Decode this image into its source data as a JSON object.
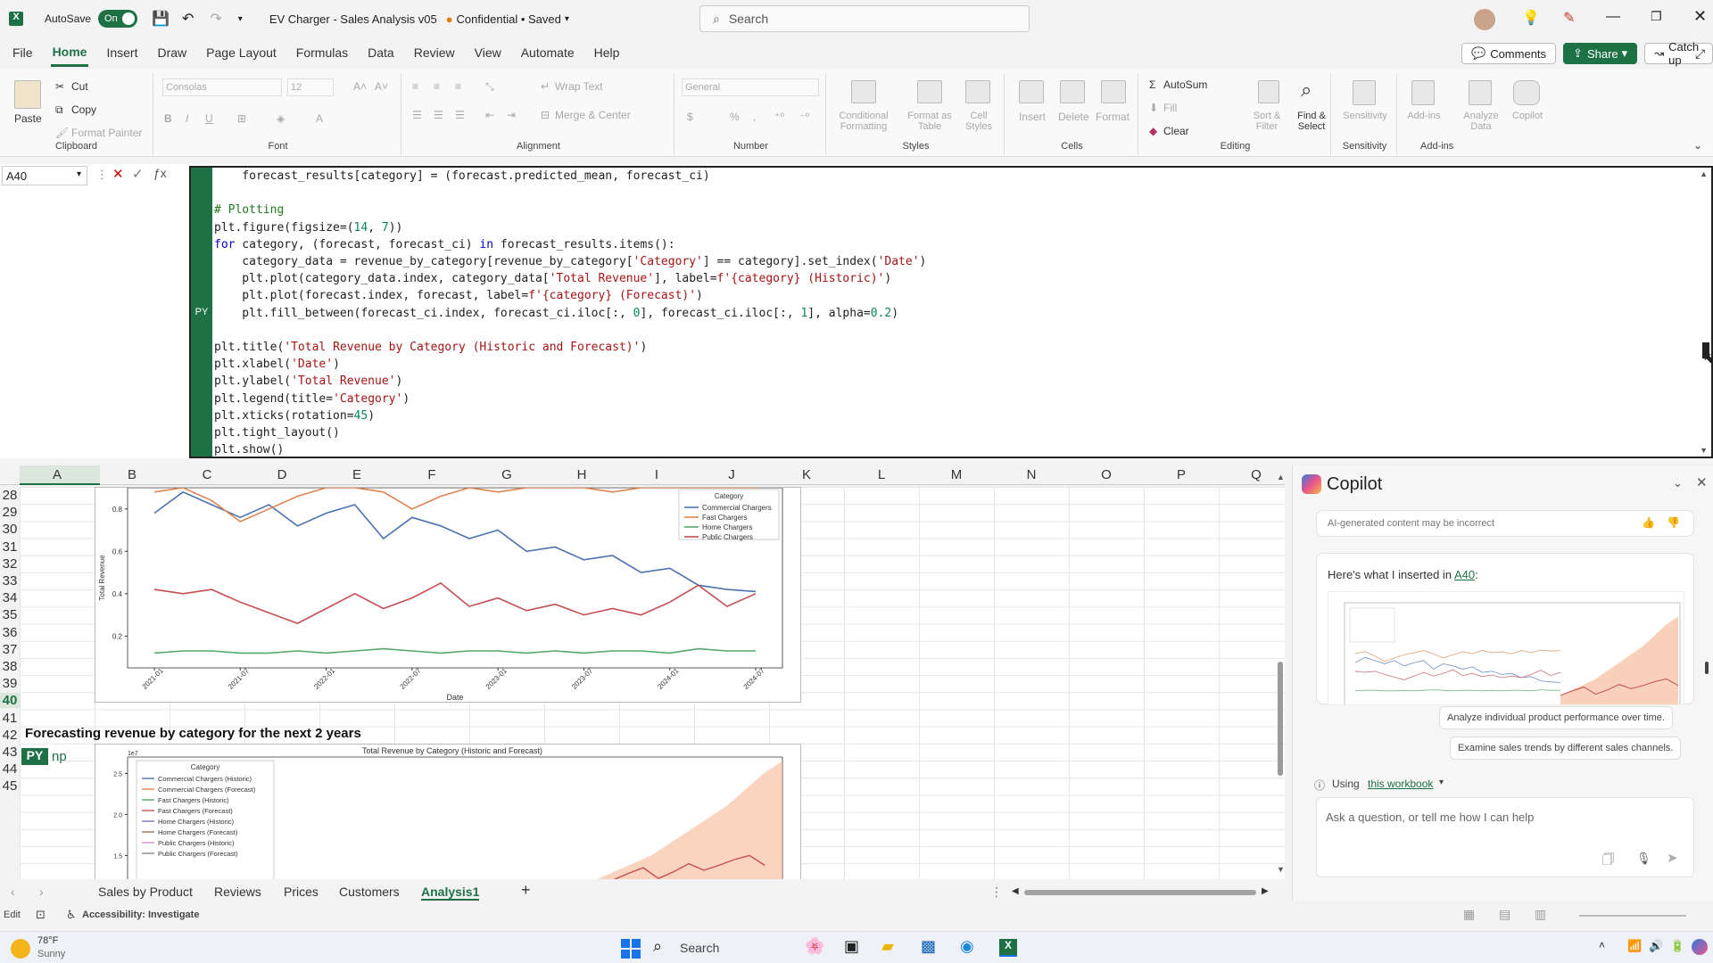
{
  "titlebar": {
    "autosave_label": "AutoSave",
    "autosave_state": "On",
    "filename": "EV Charger - Sales Analysis v05",
    "sensitivity": "Confidential • Saved",
    "search_placeholder": "Search"
  },
  "menu": {
    "items": [
      "File",
      "Home",
      "Insert",
      "Draw",
      "Page Layout",
      "Formulas",
      "Data",
      "Review",
      "View",
      "Automate",
      "Help"
    ],
    "active": "Home",
    "comments": "Comments",
    "share": "Share",
    "catchup": "Catch up"
  },
  "ribbon": {
    "clipboard": {
      "paste": "Paste",
      "cut": "Cut",
      "copy": "Copy",
      "format_painter": "Format Painter",
      "label": "Clipboard"
    },
    "font": {
      "name": "Consolas",
      "size": "12",
      "label": "Font"
    },
    "alignment": {
      "wrap": "Wrap Text",
      "merge": "Merge & Center",
      "label": "Alignment"
    },
    "number": {
      "format": "General",
      "label": "Number"
    },
    "styles": {
      "conditional": "Conditional Formatting",
      "table": "Format as Table",
      "cell": "Cell Styles",
      "label": "Styles"
    },
    "cells": {
      "insert": "Insert",
      "delete": "Delete",
      "format": "Format",
      "label": "Cells"
    },
    "editing": {
      "autosum": "AutoSum",
      "fill": "Fill",
      "clear": "Clear",
      "sort": "Sort & Filter",
      "find": "Find & Select",
      "label": "Editing"
    },
    "sensitivity": {
      "btn": "Sensitivity",
      "label": "Sensitivity"
    },
    "addins": {
      "btn": "Add-ins",
      "analyze": "Analyze Data",
      "copilot": "Copilot",
      "label": "Add-ins"
    }
  },
  "formula": {
    "cell_ref": "A40",
    "py_badge": "PY"
  },
  "grid": {
    "columns": [
      "A",
      "B",
      "C",
      "D",
      "E",
      "F",
      "G",
      "H",
      "I",
      "J",
      "K",
      "L",
      "M",
      "N",
      "O",
      "P",
      "Q"
    ],
    "rows": [
      "28",
      "29",
      "30",
      "31",
      "32",
      "33",
      "34",
      "35",
      "36",
      "37",
      "38",
      "39",
      "40",
      "41",
      "42",
      "43",
      "44",
      "45"
    ],
    "heading_row39": "Forecasting revenue by category for the next 2 years",
    "cell_a40_badge": "PY",
    "cell_a40_text": "np"
  },
  "chart_data": [
    {
      "type": "line",
      "ylabel": "Total Revenue",
      "xlabel": "Date",
      "x": [
        "2021-01",
        "2021-07",
        "2022-01",
        "2022-07",
        "2023-01",
        "2023-07",
        "2024-01",
        "2024-07"
      ],
      "ytick_labels": [
        "0.2",
        "0.4",
        "0.6",
        "0.8"
      ],
      "legend_title": "Category",
      "legend_position": "top-right",
      "series": [
        {
          "name": "Commercial Chargers",
          "color": "#4c72b0",
          "values": [
            0.78,
            0.88,
            0.82,
            0.76,
            0.82,
            0.72,
            0.78,
            0.82,
            0.66,
            0.76,
            0.72,
            0.66,
            0.7,
            0.6,
            0.62,
            0.56,
            0.58,
            0.5,
            0.52,
            0.44,
            0.42,
            0.41
          ]
        },
        {
          "name": "Fast Chargers",
          "color": "#dd8452",
          "values": [
            0.88,
            0.92,
            0.84,
            0.74,
            0.8,
            0.86,
            0.9,
            0.94,
            0.88,
            0.8,
            0.86,
            0.92,
            0.88,
            0.94,
            0.9,
            0.92,
            0.88,
            0.94,
            0.9,
            0.95,
            0.93,
            0.94
          ]
        },
        {
          "name": "Home Chargers",
          "color": "#55a868",
          "values": [
            0.12,
            0.13,
            0.13,
            0.12,
            0.12,
            0.13,
            0.12,
            0.13,
            0.14,
            0.13,
            0.12,
            0.13,
            0.13,
            0.12,
            0.13,
            0.12,
            0.13,
            0.13,
            0.12,
            0.14,
            0.13,
            0.13
          ]
        },
        {
          "name": "Public Chargers",
          "color": "#c44e52",
          "values": [
            0.42,
            0.4,
            0.42,
            0.36,
            0.31,
            0.26,
            0.33,
            0.4,
            0.33,
            0.38,
            0.45,
            0.34,
            0.38,
            0.32,
            0.35,
            0.3,
            0.33,
            0.3,
            0.36,
            0.44,
            0.34,
            0.4
          ]
        }
      ]
    },
    {
      "type": "area",
      "title": "Total Revenue by Category (Historic and Forecast)",
      "ytick_labels": [
        "1.5",
        "2.0",
        "2.5"
      ],
      "legend_title": "Category",
      "legend_position": "top-left",
      "scale_label": "1e7",
      "legend": [
        {
          "name": "Commercial Chargers (Historic)",
          "color": "#4c72b0"
        },
        {
          "name": "Commercial Chargers (Forecast)",
          "color": "#dd8452"
        },
        {
          "name": "Fast Chargers (Historic)",
          "color": "#55a868"
        },
        {
          "name": "Fast Chargers (Forecast)",
          "color": "#c44e52"
        },
        {
          "name": "Home Chargers (Historic)",
          "color": "#8172b3"
        },
        {
          "name": "Home Chargers (Forecast)",
          "color": "#937860"
        },
        {
          "name": "Public Chargers (Historic)",
          "color": "#da8bc3"
        },
        {
          "name": "Public Chargers (Forecast)",
          "color": "#8c8c8c"
        }
      ],
      "forecast_band": [
        1.2,
        1.3,
        1.4,
        1.5,
        1.65,
        1.8,
        1.95,
        2.1,
        2.3,
        2.5,
        2.65
      ],
      "forecast_line": [
        1.2,
        1.28,
        1.35,
        1.22,
        1.3,
        1.4,
        1.32,
        1.38,
        1.45,
        1.5,
        1.38
      ]
    }
  ],
  "copilot": {
    "title": "Copilot",
    "disclaimer": "AI-generated content may be incorrect",
    "inserted_prefix": "Here's what I inserted in",
    "inserted_ref": "A40",
    "suggestion1": "Analyze individual product performance over time.",
    "suggestion2": "Examine sales trends by different sales channels.",
    "using_prefix": "Using",
    "using_link": "this workbook",
    "input_placeholder": "Ask a question, or tell me how I can help"
  },
  "sheets": {
    "tabs": [
      "Sales by Product",
      "Reviews",
      "Prices",
      "Customers",
      "Analysis1"
    ],
    "active": "Analysis1"
  },
  "status": {
    "mode": "Edit",
    "accessibility": "Accessibility: Investigate"
  },
  "taskbar": {
    "temp": "78°F",
    "weather": "Sunny",
    "search": "Search"
  }
}
